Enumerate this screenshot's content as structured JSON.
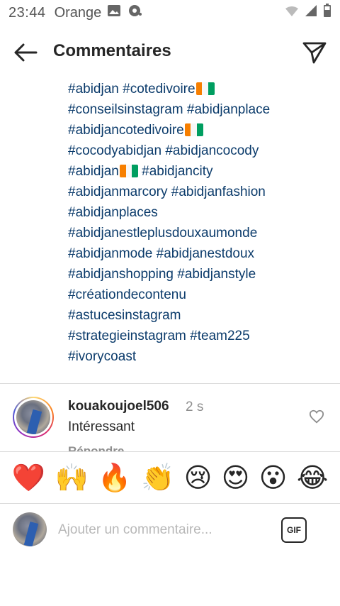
{
  "status_bar": {
    "time": "23:44",
    "carrier": "Orange"
  },
  "header": {
    "title": "Commentaires"
  },
  "caption": {
    "lines": [
      [
        "#abidjan",
        "#cotedivoire",
        "flag"
      ],
      [
        "#conseilsinstagram",
        "#abidjanplace"
      ],
      [
        "#abidjancotedivoire",
        "flag"
      ],
      [
        "#cocodyabidjan",
        "#abidjancocody"
      ],
      [
        "#abidjan",
        "flag",
        "#abidjancity"
      ],
      [
        "#abidjanmarcory",
        "#abidjanfashion"
      ],
      [
        "#abidjanplaces"
      ],
      [
        "#abidjanestleplusdouxaumonde"
      ],
      [
        "#abidjanmode",
        "#abidjanestdoux"
      ],
      [
        "#abidjanshopping",
        "#abidjanstyle"
      ],
      [
        "#créationdecontenu"
      ],
      [
        "#astucesinstagram"
      ],
      [
        "#strategieinstagram",
        "#team225"
      ],
      [
        "#ivorycoast"
      ]
    ]
  },
  "comment": {
    "username": "kouakoujoel506",
    "time": "2 s",
    "text": "Intéressant",
    "reply_label": "Répondre"
  },
  "emoji_bar": {
    "emojis": [
      "❤️",
      "🙌",
      "🔥",
      "👏",
      "😢",
      "😍",
      "😮",
      "😂"
    ]
  },
  "input": {
    "placeholder": "Ajouter un commentaire...",
    "gif_label": "GIF"
  },
  "colors": {
    "hashtag": "#0b3b6b",
    "muted": "#8e8e8e"
  }
}
